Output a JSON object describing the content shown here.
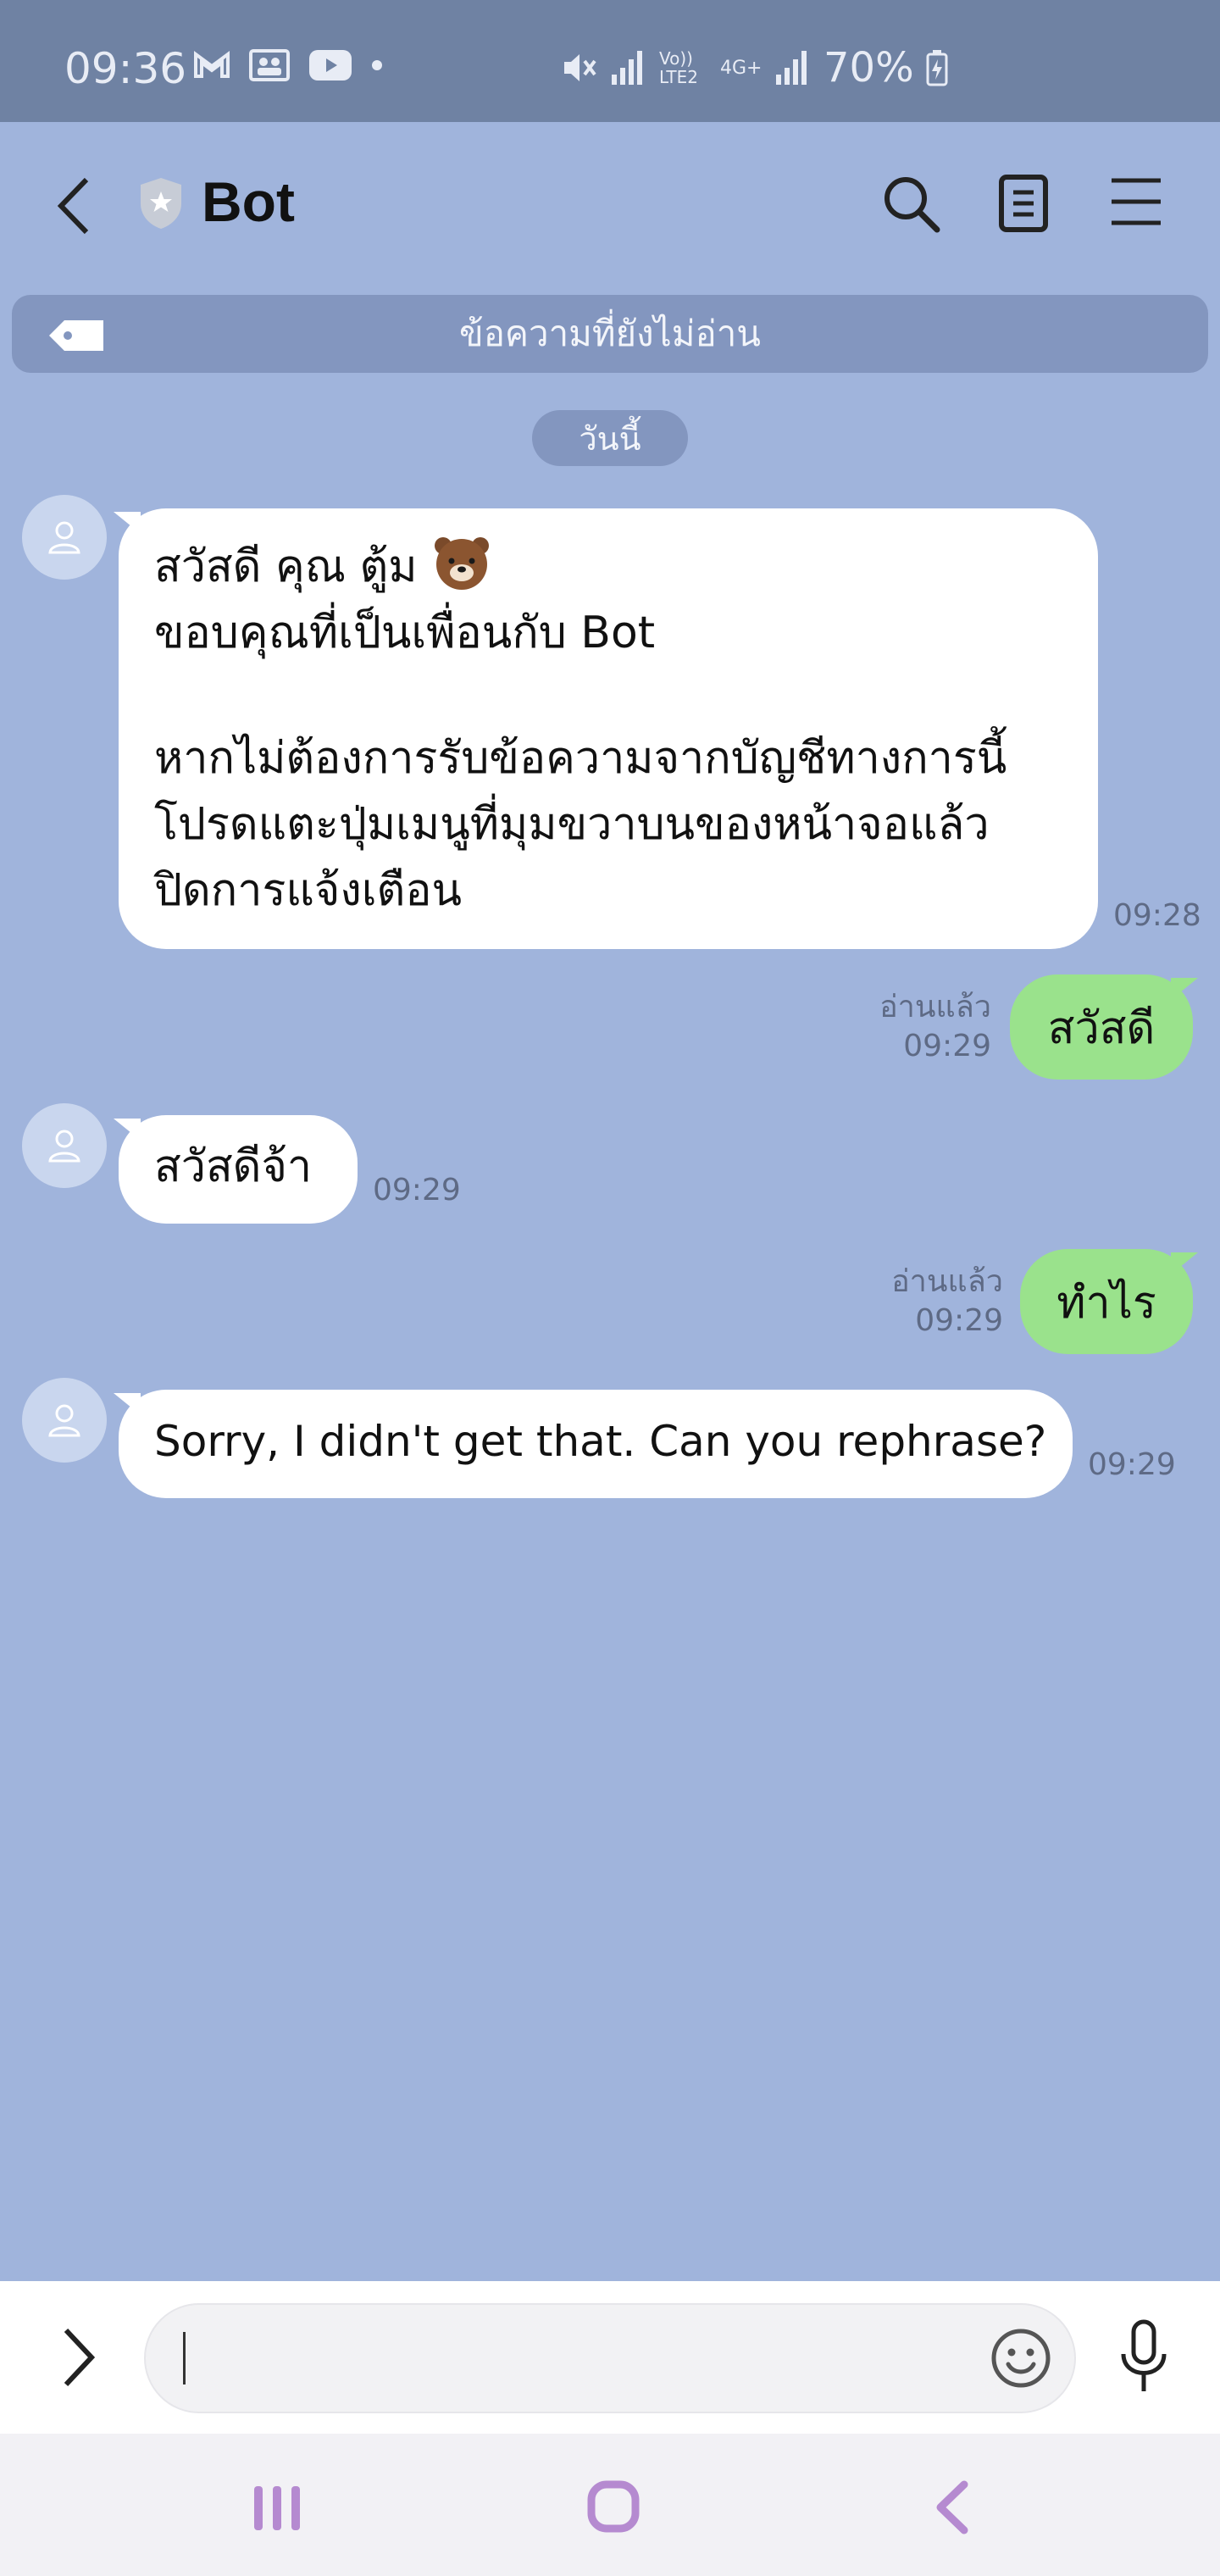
{
  "status_bar": {
    "time": "09:36",
    "battery": "70%",
    "network_text_1": "Vo)) LTE2",
    "network_text_2": "4G+"
  },
  "header": {
    "title": "Bot",
    "icons": [
      "back-icon",
      "shield-icon",
      "search-icon",
      "notes-icon",
      "menu-icon"
    ]
  },
  "banner": {
    "unread_label": "ข้อความที่ยังไม่อ่าน"
  },
  "date_separator": "วันนี้",
  "messages": [
    {
      "side": "in",
      "lines": [
        "สวัสดี คุณ ตู้ม",
        "ขอบคุณที่เป็นเพื่อนกับ Bot",
        "",
        "หากไม่ต้องการรับข้อความจากบัญชีทางการนี้",
        "โปรดแตะปุ่มเมนูที่มุมขวาบนของหน้าจอแล้ว",
        "ปิดการแจ้งเตือน"
      ],
      "time": "09:28"
    },
    {
      "side": "out",
      "text": "สวัสดี",
      "read": "อ่านแล้ว",
      "time": "09:29"
    },
    {
      "side": "in",
      "text": "สวัสดีจ้า",
      "time": "09:29"
    },
    {
      "side": "out",
      "text": "ทำไร",
      "read": "อ่านแล้ว",
      "time": "09:29"
    },
    {
      "side": "in",
      "text": "Sorry, I didn't get that. Can you rephrase?",
      "time": "09:29"
    }
  ],
  "composer": {
    "placeholder": ""
  },
  "colors": {
    "background": "#a0b4dc",
    "status_bar": "#6f82a3",
    "bubble_in": "#ffffff",
    "bubble_out": "#9ae28c",
    "nav_icon": "#b58ad0"
  }
}
